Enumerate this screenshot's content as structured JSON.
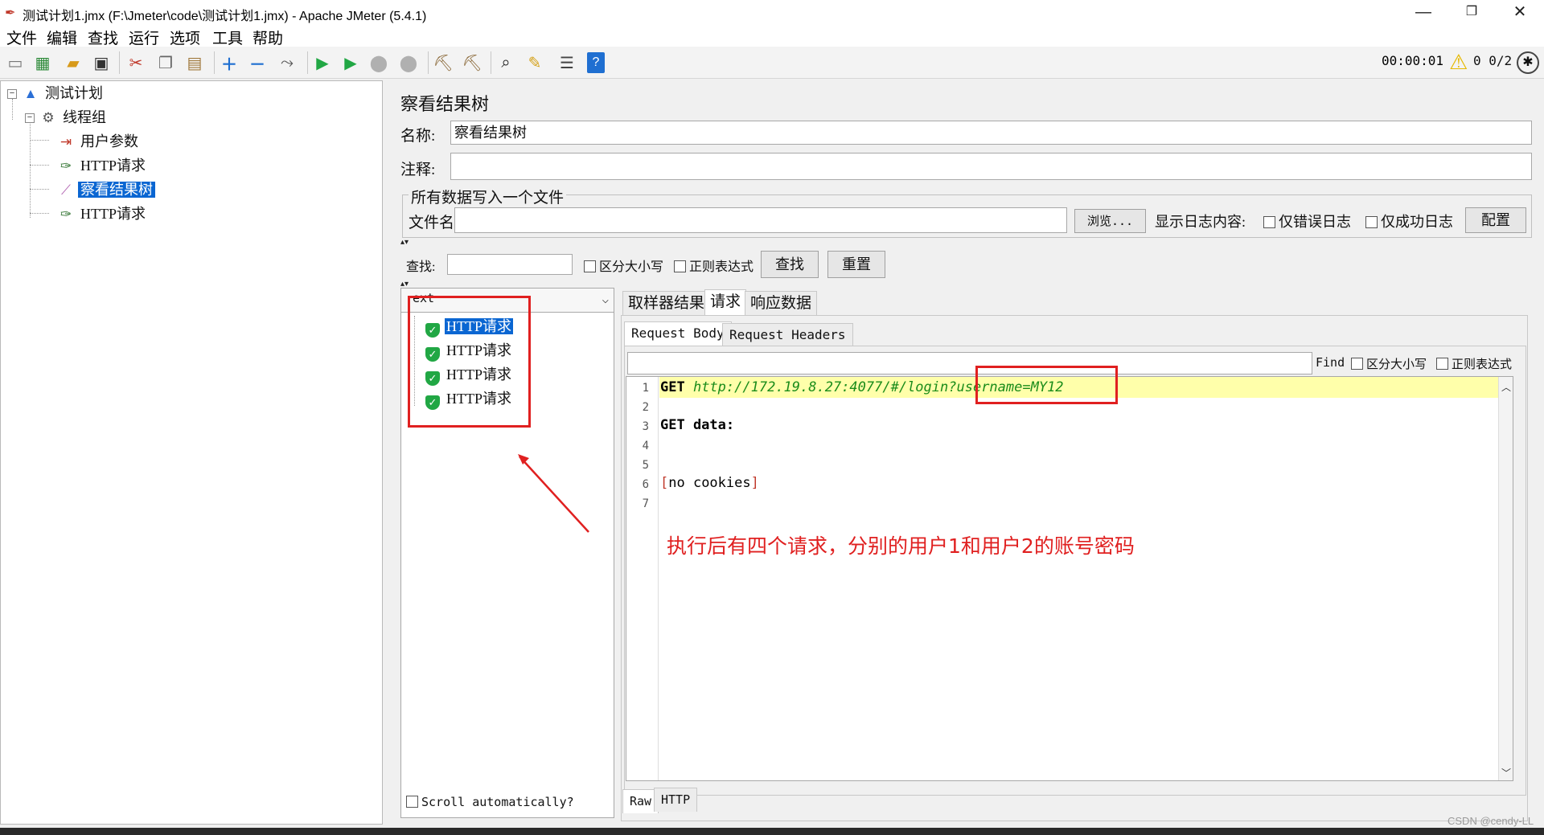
{
  "window": {
    "title": "测试计划1.jmx (F:\\Jmeter\\code\\测试计划1.jmx) - Apache JMeter (5.4.1)",
    "minimize": "—",
    "maximize": "❐",
    "close": "✕"
  },
  "menu": [
    "文件",
    "编辑",
    "查找",
    "运行",
    "选项",
    "工具",
    "帮助"
  ],
  "toolbar": {
    "timer": "00:00:01",
    "threads": "0  0/2"
  },
  "tree": {
    "plan": "测试计划",
    "thread_group": "线程组",
    "user_params": "用户参数",
    "http1": "HTTP请求",
    "result_tree": "察看结果树",
    "http2": "HTTP请求"
  },
  "panel": {
    "title": "察看结果树",
    "name_label": "名称:",
    "name_value": "察看结果树",
    "comment_label": "注释:",
    "comment_value": "",
    "file_group": "所有数据写入一个文件",
    "file_label": "文件名",
    "file_value": "",
    "browse": "浏览...",
    "log_label": "显示日志内容:",
    "errors_only": "仅错误日志",
    "success_only": "仅成功日志",
    "configure": "配置",
    "search_label": "查找:",
    "search_value": "",
    "case_sensitive": "区分大小写",
    "regex": "正则表达式",
    "find_btn": "查找",
    "reset_btn": "重置"
  },
  "results": {
    "renderer": "ext",
    "items": [
      "HTTP请求",
      "HTTP请求",
      "HTTP请求",
      "HTTP请求"
    ],
    "scroll_auto": "Scroll automatically?"
  },
  "tabs": [
    "取样器结果",
    "请求",
    "响应数据"
  ],
  "subtabs": [
    "Request Body",
    "Request Headers"
  ],
  "find_bar": {
    "label": "Find",
    "case": "区分大小写",
    "regex": "正则表达式"
  },
  "editor": {
    "line_numbers": [
      "1",
      "2",
      "3",
      "4",
      "5",
      "6",
      "7"
    ],
    "method": "GET",
    "url": "http://172.19.8.27:4077/#/login?username=MY12",
    "line3": "GET data:",
    "line6_open": "[",
    "line6_text": "no cookies",
    "line6_close": "]"
  },
  "bottom_tabs": [
    "Raw",
    "HTTP"
  ],
  "annotation": "执行后有四个请求，分别的用户1和用户2的账号密码",
  "watermark": "CSDN @cendy-LL",
  "colors": {
    "selection": "#0a66d2",
    "annotation_red": "#e02020",
    "highlight_line": "#ffffaa",
    "url_green": "#1a8c1a"
  }
}
